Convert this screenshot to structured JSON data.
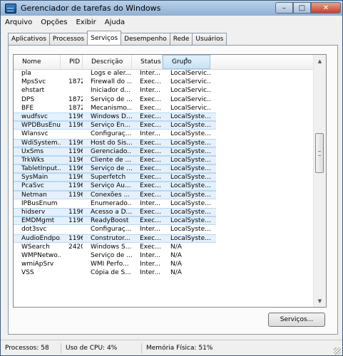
{
  "window": {
    "title": "Gerenciador de tarefas do Windows"
  },
  "menu": [
    "Arquivo",
    "Opções",
    "Exibir",
    "Ajuda"
  ],
  "tabs": [
    "Aplicativos",
    "Processos",
    "Serviços",
    "Desempenho",
    "Rede",
    "Usuários"
  ],
  "active_tab": "Serviços",
  "columns": {
    "nome": "Nome",
    "pid": "PID",
    "descricao": "Descrição",
    "status": "Status",
    "grupo": "Grupo"
  },
  "rows": [
    {
      "nome": "pla",
      "pid": "",
      "descricao": "Logs e aler...",
      "status": "Inter...",
      "grupo": "LocalServic...",
      "selected": false
    },
    {
      "nome": "MpsSvc",
      "pid": "1872",
      "descricao": "Firewall do ...",
      "status": "Exec...",
      "grupo": "LocalServic...",
      "selected": false
    },
    {
      "nome": "ehstart",
      "pid": "",
      "descricao": "Iniciador d...",
      "status": "Inter...",
      "grupo": "LocalServic...",
      "selected": false
    },
    {
      "nome": "DPS",
      "pid": "1872",
      "descricao": "Serviço de ...",
      "status": "Exec...",
      "grupo": "LocalServic...",
      "selected": false
    },
    {
      "nome": "BFE",
      "pid": "1872",
      "descricao": "Mecanismo...",
      "status": "Exec...",
      "grupo": "LocalServic...",
      "selected": false
    },
    {
      "nome": "wudfsvc",
      "pid": "1196",
      "descricao": "Windows D...",
      "status": "Exec...",
      "grupo": "LocalSyste...",
      "selected": true
    },
    {
      "nome": "WPDBusEnum",
      "pid": "1196",
      "descricao": "Serviço En...",
      "status": "Exec...",
      "grupo": "LocalSyste...",
      "selected": true
    },
    {
      "nome": "Wlansvc",
      "pid": "",
      "descricao": "Configuraç...",
      "status": "Inter...",
      "grupo": "LocalSyste...",
      "selected": false
    },
    {
      "nome": "WdiSystem...",
      "pid": "1196",
      "descricao": "Host do Sis...",
      "status": "Exec...",
      "grupo": "LocalSyste...",
      "selected": true
    },
    {
      "nome": "UxSms",
      "pid": "1196",
      "descricao": "Gerenciado...",
      "status": "Exec...",
      "grupo": "LocalSyste...",
      "selected": true
    },
    {
      "nome": "TrkWks",
      "pid": "1196",
      "descricao": "Cliente de ...",
      "status": "Exec...",
      "grupo": "LocalSyste...",
      "selected": true
    },
    {
      "nome": "TabletInput...",
      "pid": "1196",
      "descricao": "Serviço de ...",
      "status": "Exec...",
      "grupo": "LocalSyste...",
      "selected": true
    },
    {
      "nome": "SysMain",
      "pid": "1196",
      "descricao": "Superfetch",
      "status": "Exec...",
      "grupo": "LocalSyste...",
      "selected": true
    },
    {
      "nome": "PcaSvc",
      "pid": "1196",
      "descricao": "Serviço Au...",
      "status": "Exec...",
      "grupo": "LocalSyste...",
      "selected": true
    },
    {
      "nome": "Netman",
      "pid": "1196",
      "descricao": "Conexões ...",
      "status": "Exec...",
      "grupo": "LocalSyste...",
      "selected": true
    },
    {
      "nome": "IPBusEnum",
      "pid": "",
      "descricao": "Enumerado...",
      "status": "Inter...",
      "grupo": "LocalSyste...",
      "selected": false
    },
    {
      "nome": "hidserv",
      "pid": "1196",
      "descricao": "Acesso a D...",
      "status": "Exec...",
      "grupo": "LocalSyste...",
      "selected": true
    },
    {
      "nome": "EMDMgmt",
      "pid": "1196",
      "descricao": "ReadyBoost",
      "status": "Exec...",
      "grupo": "LocalSyste...",
      "selected": true
    },
    {
      "nome": "dot3svc",
      "pid": "",
      "descricao": "Configuraç...",
      "status": "Inter...",
      "grupo": "LocalSyste...",
      "selected": false
    },
    {
      "nome": "AudioEndpo...",
      "pid": "1196",
      "descricao": "Construtor...",
      "status": "Exec...",
      "grupo": "LocalSyste...",
      "selected": true
    },
    {
      "nome": "WSearch",
      "pid": "2420",
      "descricao": "Windows S...",
      "status": "Exec...",
      "grupo": "N/A",
      "selected": false
    },
    {
      "nome": "WMPNetwo...",
      "pid": "",
      "descricao": "Serviço de ...",
      "status": "Inter...",
      "grupo": "N/A",
      "selected": false
    },
    {
      "nome": "wmiApSrv",
      "pid": "",
      "descricao": "WMI Perfo...",
      "status": "Inter...",
      "grupo": "N/A",
      "selected": false
    },
    {
      "nome": "VSS",
      "pid": "",
      "descricao": "Cópia de S...",
      "status": "Inter...",
      "grupo": "N/A",
      "selected": false
    }
  ],
  "services_button": "Serviços...",
  "status": {
    "processes": "Processos: 58",
    "cpu": "Uso de CPU: 4%",
    "memory": "Memória Física: 51%"
  },
  "colors": {
    "selected_row": "#e4f0fb",
    "title_gradient_top": "#b9d1ea"
  }
}
